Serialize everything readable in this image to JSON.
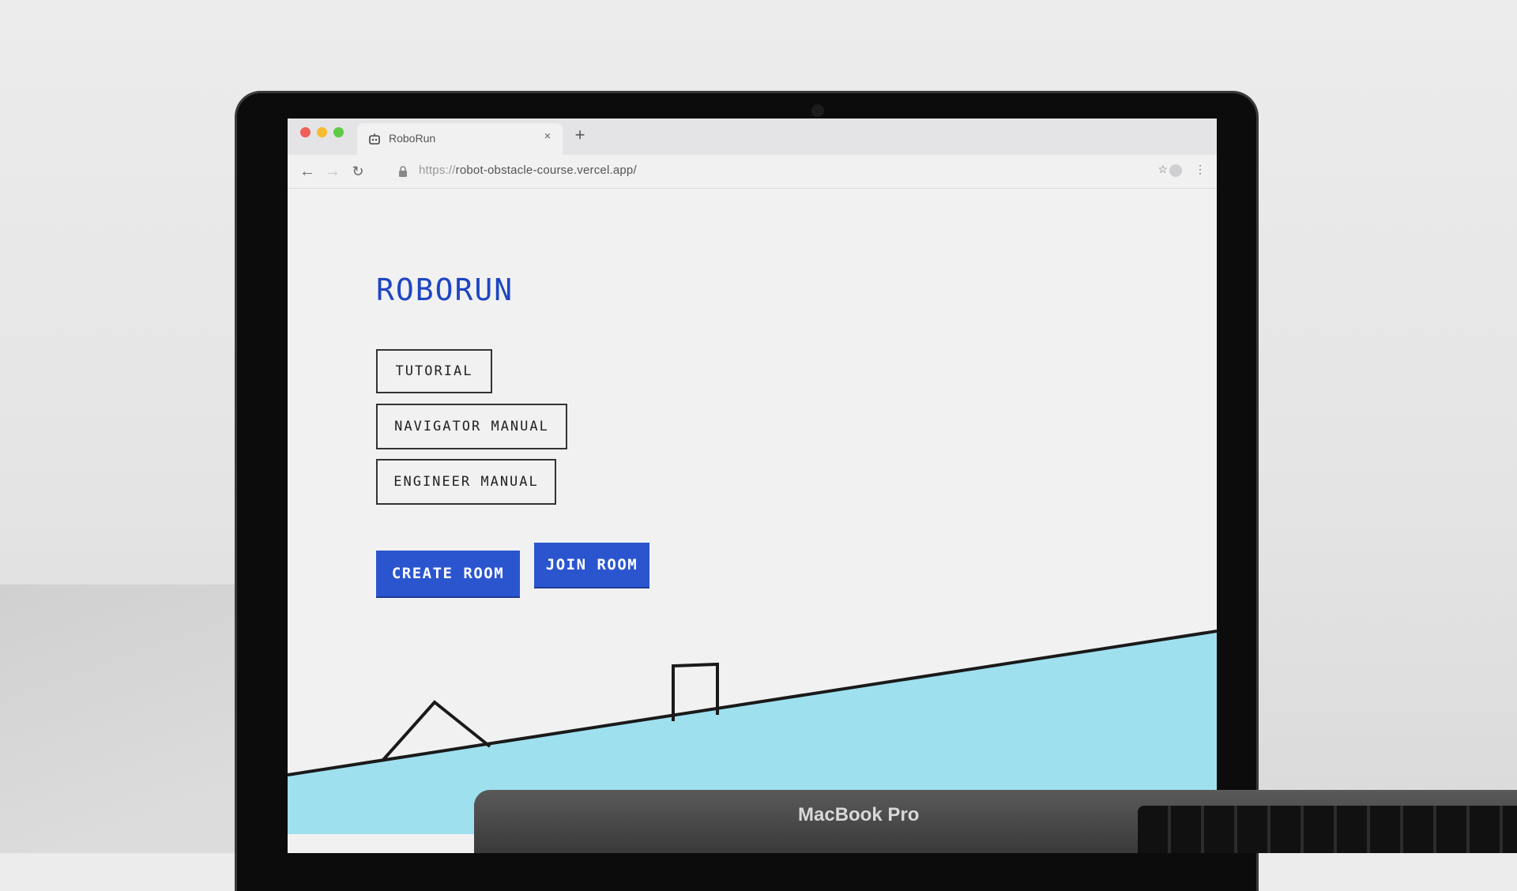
{
  "browser": {
    "tab_title": "RoboRun",
    "new_tab_symbol": "+",
    "close_symbol": "×",
    "url_protocol": "https://",
    "url_host": "robot-obstacle-course.vercel.app/"
  },
  "page": {
    "logo": "ROBORUN",
    "menu": [
      {
        "label": "TUTORIAL"
      },
      {
        "label": "NAVIGATOR MANUAL"
      },
      {
        "label": "ENGINEER MANUAL"
      }
    ],
    "actions": {
      "create": "CREATE ROOM",
      "join": "JOIN ROOM"
    }
  },
  "device": {
    "label": "MacBook Pro"
  },
  "colors": {
    "brand_blue": "#1e45c2",
    "button_blue": "#2b55cf",
    "ground": "#9fe0ef",
    "page_bg": "#f1f1f2"
  },
  "icons": {
    "back": "arrow-left-icon",
    "forward": "arrow-right-icon",
    "reload": "reload-icon",
    "lock": "lock-icon",
    "star": "star-icon",
    "profile": "profile-icon",
    "more": "more-vert-icon",
    "tab": "robot-icon"
  }
}
